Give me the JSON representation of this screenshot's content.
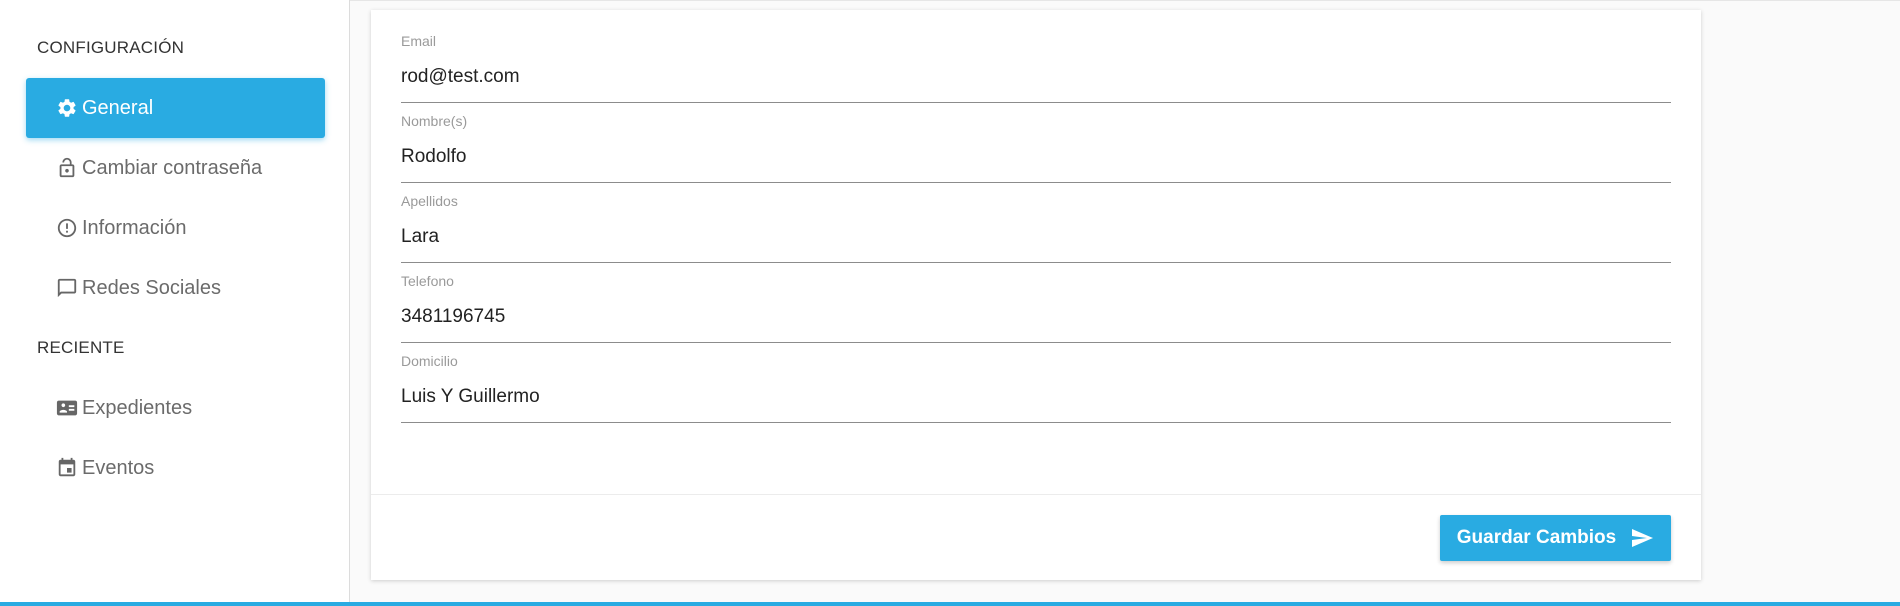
{
  "sidebar": {
    "config_title": "CONFIGURACIÓN",
    "config_items": [
      {
        "label": "General",
        "icon": "gear-icon",
        "active": true
      },
      {
        "label": "Cambiar contraseña",
        "icon": "lock-icon"
      },
      {
        "label": "Información",
        "icon": "info-icon"
      },
      {
        "label": "Redes Sociales",
        "icon": "chat-icon"
      }
    ],
    "recent_title": "RECIENTE",
    "recent_items": [
      {
        "label": "Expedientes",
        "icon": "id-card-icon"
      },
      {
        "label": "Eventos",
        "icon": "calendar-icon"
      }
    ]
  },
  "form": {
    "fields": [
      {
        "label": "Email",
        "value": "rod@test.com"
      },
      {
        "label": "Nombre(s)",
        "value": "Rodolfo"
      },
      {
        "label": "Apellidos",
        "value": "Lara"
      },
      {
        "label": "Telefono",
        "value": "3481196745"
      },
      {
        "label": "Domicilio",
        "value": "Luis Y Guillermo"
      }
    ],
    "save_label": "Guardar Cambios",
    "save_icon": "send-icon"
  },
  "colors": {
    "accent": "#29abe2",
    "text_muted": "#6b6b6b"
  }
}
